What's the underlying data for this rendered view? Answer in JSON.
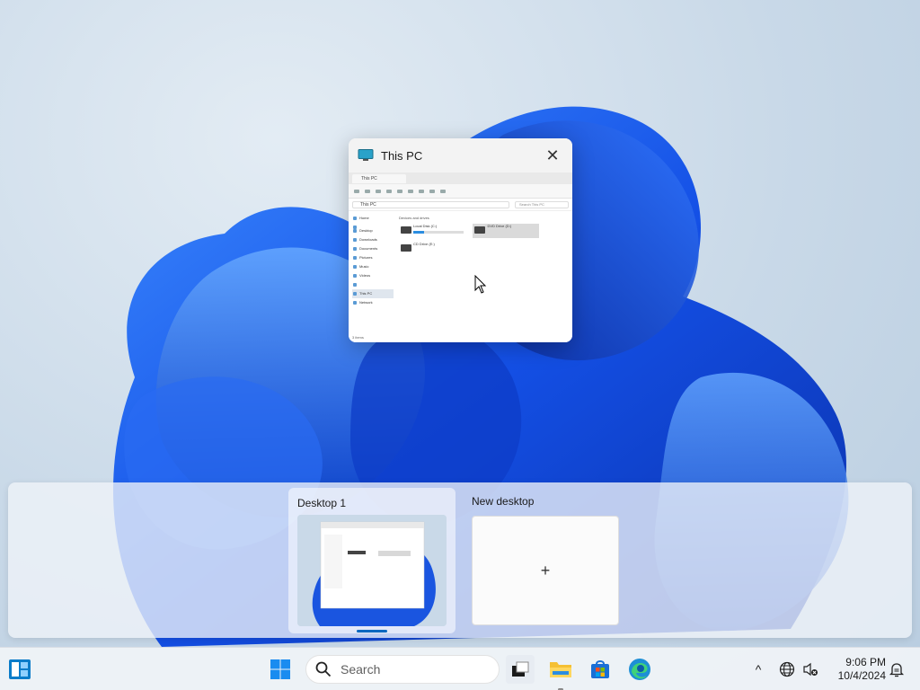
{
  "window_preview": {
    "title": "This PC",
    "close_glyph": "✕",
    "icon": "monitor-icon",
    "explorer": {
      "tab_label": "This PC",
      "address": "This PC",
      "search_placeholder": "Search This PC",
      "nav_items": [
        "Home",
        "Desktop",
        "Downloads",
        "Documents",
        "Pictures",
        "Music",
        "Videos",
        "This PC",
        "Network"
      ],
      "section_header": "Devices and drives",
      "drives": [
        {
          "name": "Local Disk (C:)",
          "detail": "free of 126 GB",
          "fill": 0.22
        },
        {
          "name": "DVD Drive (D:)",
          "detail": "CD Drive",
          "fill": 0
        },
        {
          "name": "CD Drive (E:)",
          "detail": "",
          "fill": 0
        }
      ],
      "status": "3 items"
    }
  },
  "desktops": [
    {
      "label": "Desktop 1",
      "active": true
    },
    {
      "label": "New desktop",
      "active": false,
      "add_glyph": "+"
    }
  ],
  "taskbar": {
    "search_placeholder": "Search",
    "apps": [
      "widgets-icon",
      "windows-start-icon",
      "task-view-icon",
      "file-explorer-icon",
      "microsoft-store-icon",
      "edge-icon"
    ],
    "tray": {
      "chevron": "^",
      "time": "9:06 PM",
      "date": "10/4/2024"
    }
  },
  "colors": {
    "accent": "#0067c0",
    "wallpaper_blue": "#1a55e0"
  }
}
